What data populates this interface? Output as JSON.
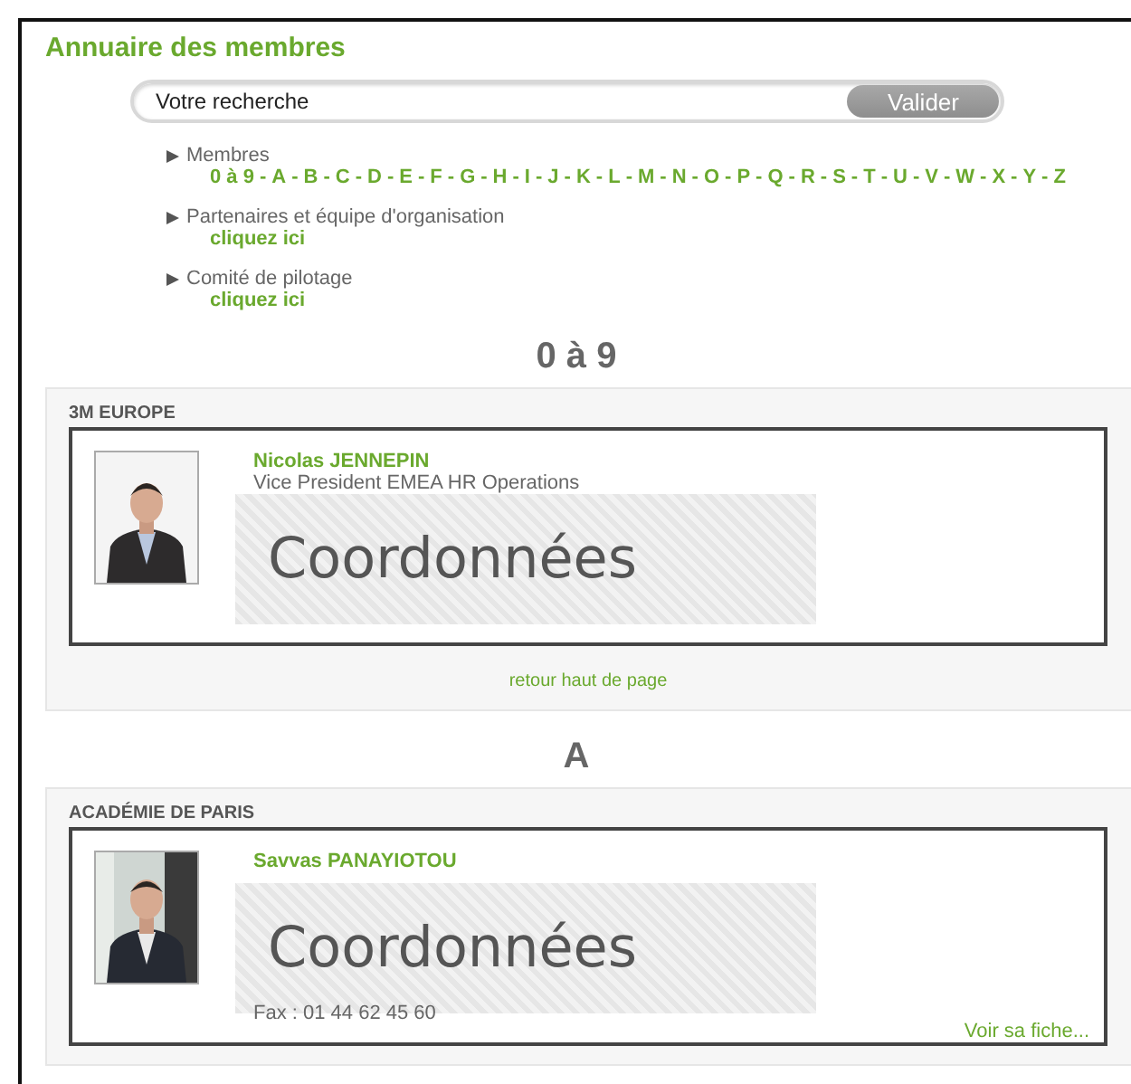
{
  "title": "Annuaire des membres",
  "search": {
    "placeholder": "Votre recherche",
    "button": "Valider"
  },
  "nav": [
    {
      "label": "Membres",
      "separator": "-",
      "links": [
        "0 à 9",
        "A",
        "B",
        "C",
        "D",
        "E",
        "F",
        "G",
        "H",
        "I",
        "J",
        "K",
        "L",
        "M",
        "N",
        "O",
        "P",
        "Q",
        "R",
        "S",
        "T",
        "U",
        "V",
        "W",
        "X",
        "Y",
        "Z"
      ]
    },
    {
      "label": "Partenaires et équipe d'organisation",
      "links": [
        "cliquez ici"
      ]
    },
    {
      "label": "Comité de pilotage",
      "links": [
        "cliquez ici"
      ]
    }
  ],
  "sections": [
    {
      "heading": "0 à 9",
      "company": "3M EUROPE",
      "member": {
        "name": "Nicolas JENNEPIN",
        "role": "Vice President EMEA HR Operations",
        "overlay": "Coordonnées"
      },
      "back_link": "retour haut de page"
    },
    {
      "heading": "A",
      "company": "ACADÉMIE DE PARIS",
      "member": {
        "name": "Savvas PANAYIOTOU",
        "fax": "Fax : 01 44 62 45 60",
        "overlay": "Coordonnées",
        "more_link": "Voir sa fiche..."
      }
    }
  ]
}
